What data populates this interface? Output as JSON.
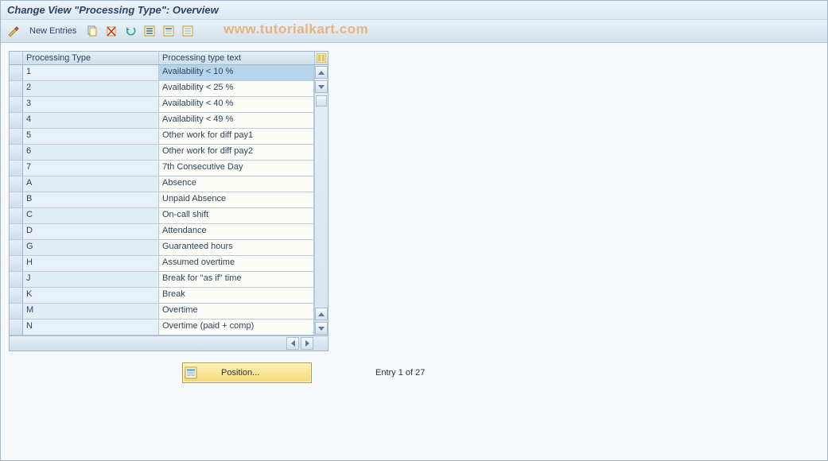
{
  "title": "Change View \"Processing Type\": Overview",
  "watermark": "www.tutorialkart.com",
  "toolbar": {
    "new_entries_label": "New Entries"
  },
  "grid": {
    "headers": {
      "col1": "Processing Type",
      "col2": "Processing type text"
    },
    "rows": [
      {
        "type": "1",
        "text": "Availability < 10 %",
        "selected": true
      },
      {
        "type": "2",
        "text": "Availability < 25 %"
      },
      {
        "type": "3",
        "text": "Availability < 40 %"
      },
      {
        "type": "4",
        "text": "Availability < 49 %"
      },
      {
        "type": "5",
        "text": "Other work for diff pay1"
      },
      {
        "type": "6",
        "text": "Other work for diff pay2"
      },
      {
        "type": "7",
        "text": "7th Consecutive Day"
      },
      {
        "type": "A",
        "text": "Absence"
      },
      {
        "type": "B",
        "text": "Unpaid Absence"
      },
      {
        "type": "C",
        "text": "On-call shift"
      },
      {
        "type": "D",
        "text": "Attendance"
      },
      {
        "type": "G",
        "text": "Guaranteed hours"
      },
      {
        "type": "H",
        "text": "Assumed overtime"
      },
      {
        "type": "J",
        "text": "Break for \"as if\" time"
      },
      {
        "type": "K",
        "text": "Break"
      },
      {
        "type": "M",
        "text": "Overtime"
      },
      {
        "type": "N",
        "text": "Overtime (paid + comp)"
      }
    ]
  },
  "footer": {
    "position_label": "Position...",
    "entry_text": "Entry 1 of 27"
  }
}
